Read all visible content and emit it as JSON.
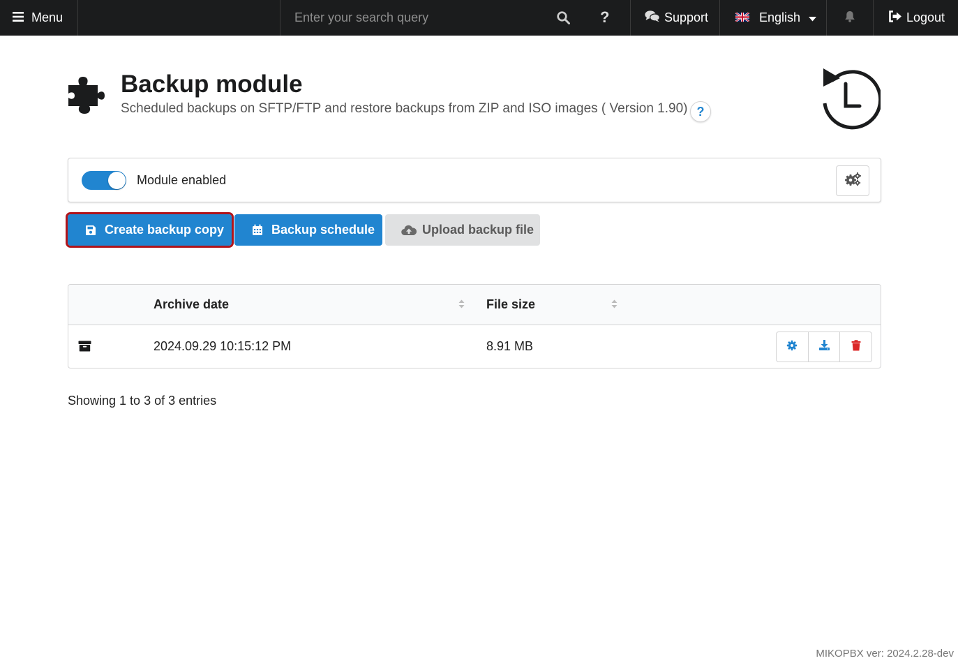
{
  "topbar": {
    "menu_label": "Menu",
    "search_placeholder": "Enter your search query",
    "help_label": "?",
    "support_label": "Support",
    "language_label": "English",
    "logout_label": "Logout"
  },
  "header": {
    "title": "Backup module",
    "subtitle": "Scheduled backups on SFTP/FTP and restore backups from ZIP and ISO images ( Version 1.90)",
    "help_label": "?"
  },
  "module": {
    "enabled": true,
    "label": "Module enabled"
  },
  "actions": {
    "create_label": "Create backup copy",
    "schedule_label": "Backup schedule",
    "upload_label": "Upload backup file"
  },
  "table": {
    "columns": [
      "",
      "Archive date",
      "File size",
      ""
    ],
    "rows": [
      {
        "date": "2024.09.29 10:15:12 PM",
        "size": "8.91 MB"
      }
    ]
  },
  "footer": {
    "entries_text": "Showing 1 to 3 of 3 entries",
    "version_text": "MIKOPBX ver: 2024.2.28-dev"
  },
  "colors": {
    "topbar": "#1b1c1d",
    "primary": "#2185d0",
    "highlight_border": "#b0141b",
    "delete": "#db2828"
  },
  "icons": [
    "bars-icon",
    "search-icon",
    "question-icon",
    "comments-icon",
    "flag-uk-icon",
    "caret-down-icon",
    "bell-icon",
    "sign-out-icon",
    "puzzle-icon",
    "history-icon",
    "cogs-icon",
    "save-icon",
    "calendar-icon",
    "cloud-upload-icon",
    "sort-icon",
    "archive-icon",
    "cog-icon",
    "download-icon",
    "trash-icon"
  ]
}
